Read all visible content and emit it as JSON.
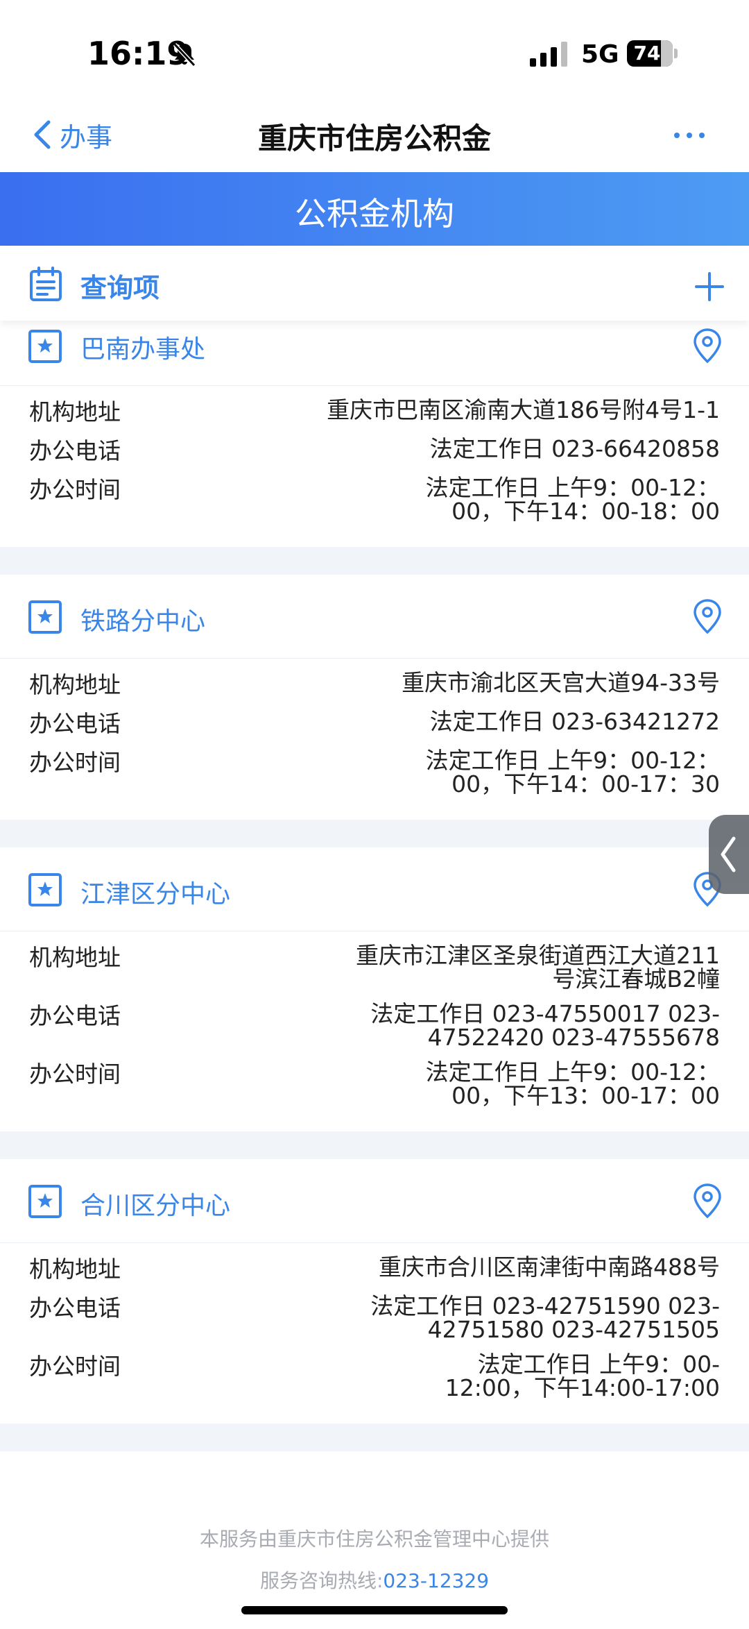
{
  "status_bar": {
    "time": "16:19",
    "network": "5G",
    "battery": "74",
    "battery_level": 0.74
  },
  "nav": {
    "back_label": "办事",
    "title": "重庆市住房公积金"
  },
  "banner": {
    "title": "公积金机构"
  },
  "query_bar": {
    "label": "查询项"
  },
  "offices": [
    {
      "name": "巴南办事处",
      "rows": [
        {
          "label": "机构地址",
          "value": "重庆市巴南区渝南大道186号附4号1-1"
        },
        {
          "label": "办公电话",
          "value": "法定工作日 023-66420858"
        },
        {
          "label": "办公时间",
          "value": "法定工作日 上午9：00-12：00，下午14：00-18：00"
        }
      ]
    },
    {
      "name": "铁路分中心",
      "rows": [
        {
          "label": "机构地址",
          "value": "重庆市渝北区天宫大道94-33号"
        },
        {
          "label": "办公电话",
          "value": "法定工作日 023-63421272"
        },
        {
          "label": "办公时间",
          "value": "法定工作日 上午9：00-12：00，下午14：00-17：30"
        }
      ]
    },
    {
      "name": "江津区分中心",
      "rows": [
        {
          "label": "机构地址",
          "value": "重庆市江津区圣泉街道西江大道211号滨江春城B2幢"
        },
        {
          "label": "办公电话",
          "value": "法定工作日 023-47550017 023-47522420 023-47555678"
        },
        {
          "label": "办公时间",
          "value": "法定工作日 上午9：00-12：00，下午13：00-17：00"
        }
      ]
    },
    {
      "name": "合川区分中心",
      "rows": [
        {
          "label": "机构地址",
          "value": "重庆市合川区南津街中南路488号"
        },
        {
          "label": "办公电话",
          "value": "法定工作日 023-42751590 023-42751580 023-42751505"
        },
        {
          "label": "办公时间",
          "value": "法定工作日 上午9：00-12:00，下午14:00-17:00"
        }
      ]
    }
  ],
  "footer": {
    "provider": "本服务由重庆市住房公积金管理中心提供",
    "hotline_label": "服务咨询热线:",
    "hotline_number": "023-12329"
  },
  "colors": {
    "accent": "#3a86e8",
    "banner_start": "#3a6ff0",
    "banner_end": "#4d9cf3",
    "section_gap": "#f1f4f9"
  },
  "icons": [
    "bell-slash-icon",
    "signal-icon",
    "battery-icon",
    "back-chevron-icon",
    "more-icon",
    "clipboard-list-icon",
    "plus-icon",
    "star-icon",
    "location-pin-icon",
    "chevron-left-icon"
  ]
}
